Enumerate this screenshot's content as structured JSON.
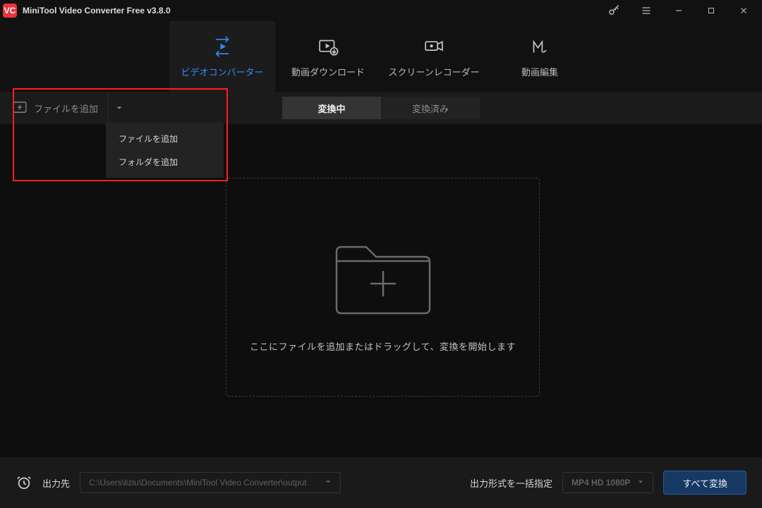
{
  "titlebar": {
    "logo_text": "VC",
    "title": "MiniTool Video Converter Free v3.8.0"
  },
  "main_tabs": [
    {
      "label": "ビデオコンバーター",
      "active": true
    },
    {
      "label": "動画ダウンロード",
      "active": false
    },
    {
      "label": "スクリーンレコーダー",
      "active": false
    },
    {
      "label": "動画編集",
      "active": false
    }
  ],
  "toolbar": {
    "add_file_label": "ファイルを追加"
  },
  "status_tabs": {
    "converting": "変換中",
    "converted": "変換済み"
  },
  "dropdown": {
    "add_file": "ファイルを追加",
    "add_folder": "フォルダを追加"
  },
  "dropzone": {
    "hint": "ここにファイルを追加またはドラッグして、変換を開始します"
  },
  "bottombar": {
    "output_label": "出力先",
    "output_path": "C:\\Users\\lizlu\\Documents\\MiniTool Video Converter\\output",
    "format_label": "出力形式を一括指定",
    "format_value": "MP4 HD 1080P",
    "convert_all": "すべて変換"
  }
}
